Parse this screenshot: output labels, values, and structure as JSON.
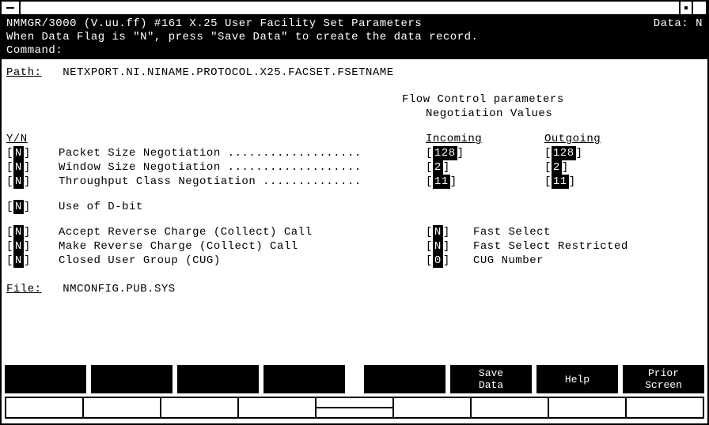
{
  "header": {
    "title_left": "NMMGR/3000 (V.uu.ff) #161  X.25 User Facility Set Parameters",
    "title_right": "Data: N",
    "instruction": "When Data Flag is \"N\", press \"Save Data\" to create the data record.",
    "command_label": "Command:"
  },
  "path": {
    "label": "Path:",
    "value": "NETXPORT.NI.NINAME.PROTOCOL.X25.FACSET.FSETNAME"
  },
  "flow": {
    "title": "Flow Control parameters",
    "subtitle": "Negotiation Values",
    "yn_header": "Y/N",
    "in_header": "Incoming",
    "out_header": "Outgoing"
  },
  "params": [
    {
      "yn": "N",
      "label": "Packet Size Negotiation ...................",
      "in": "128 ",
      "out": "128 "
    },
    {
      "yn": "N",
      "label": "Window Size Negotiation ...................",
      "in": "2   ",
      "out": "2   "
    },
    {
      "yn": "N",
      "label": "Throughput Class Negotiation ..............",
      "in": "11",
      "out": "11"
    }
  ],
  "dbit": {
    "yn": "N",
    "label": "Use of D-bit"
  },
  "opts_left": [
    {
      "yn": "N",
      "label": "Accept Reverse Charge (Collect) Call"
    },
    {
      "yn": "N",
      "label": "Make Reverse Charge (Collect) Call"
    },
    {
      "yn": "N",
      "label": "Closed User Group (CUG)"
    }
  ],
  "opts_right": [
    {
      "yn": "N",
      "label": "Fast Select"
    },
    {
      "yn": "N",
      "label": "Fast Select Restricted"
    },
    {
      "val": "0 ",
      "label": "CUG Number"
    }
  ],
  "file": {
    "label": "File:",
    "value": "NMCONFIG.PUB.SYS"
  },
  "fkeys": {
    "f6a": "Save",
    "f6b": "Data",
    "f7": "Help",
    "f8a": "Prior",
    "f8b": "Screen"
  }
}
